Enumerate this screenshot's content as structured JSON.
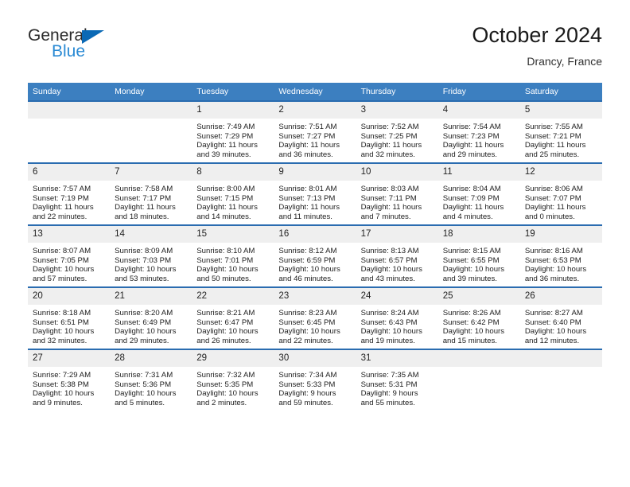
{
  "brand": {
    "name_top": "General",
    "name_bottom": "Blue",
    "triangle_color": "#0a69b5",
    "blue_text_color": "#2a8ad4"
  },
  "header": {
    "title": "October 2024",
    "subtitle": "Drancy, France"
  },
  "theme": {
    "header_row_bg": "#3c7fc0",
    "row_border": "#2a6cb0",
    "daynum_bg": "#efefef"
  },
  "weekday_headers": [
    "Sunday",
    "Monday",
    "Tuesday",
    "Wednesday",
    "Thursday",
    "Friday",
    "Saturday"
  ],
  "weeks": [
    [
      {
        "day": "",
        "empty": true
      },
      {
        "day": "",
        "empty": true
      },
      {
        "day": "1",
        "sunrise": "Sunrise: 7:49 AM",
        "sunset": "Sunset: 7:29 PM",
        "daylight_1": "Daylight: 11 hours",
        "daylight_2": "and 39 minutes."
      },
      {
        "day": "2",
        "sunrise": "Sunrise: 7:51 AM",
        "sunset": "Sunset: 7:27 PM",
        "daylight_1": "Daylight: 11 hours",
        "daylight_2": "and 36 minutes."
      },
      {
        "day": "3",
        "sunrise": "Sunrise: 7:52 AM",
        "sunset": "Sunset: 7:25 PM",
        "daylight_1": "Daylight: 11 hours",
        "daylight_2": "and 32 minutes."
      },
      {
        "day": "4",
        "sunrise": "Sunrise: 7:54 AM",
        "sunset": "Sunset: 7:23 PM",
        "daylight_1": "Daylight: 11 hours",
        "daylight_2": "and 29 minutes."
      },
      {
        "day": "5",
        "sunrise": "Sunrise: 7:55 AM",
        "sunset": "Sunset: 7:21 PM",
        "daylight_1": "Daylight: 11 hours",
        "daylight_2": "and 25 minutes."
      }
    ],
    [
      {
        "day": "6",
        "sunrise": "Sunrise: 7:57 AM",
        "sunset": "Sunset: 7:19 PM",
        "daylight_1": "Daylight: 11 hours",
        "daylight_2": "and 22 minutes."
      },
      {
        "day": "7",
        "sunrise": "Sunrise: 7:58 AM",
        "sunset": "Sunset: 7:17 PM",
        "daylight_1": "Daylight: 11 hours",
        "daylight_2": "and 18 minutes."
      },
      {
        "day": "8",
        "sunrise": "Sunrise: 8:00 AM",
        "sunset": "Sunset: 7:15 PM",
        "daylight_1": "Daylight: 11 hours",
        "daylight_2": "and 14 minutes."
      },
      {
        "day": "9",
        "sunrise": "Sunrise: 8:01 AM",
        "sunset": "Sunset: 7:13 PM",
        "daylight_1": "Daylight: 11 hours",
        "daylight_2": "and 11 minutes."
      },
      {
        "day": "10",
        "sunrise": "Sunrise: 8:03 AM",
        "sunset": "Sunset: 7:11 PM",
        "daylight_1": "Daylight: 11 hours",
        "daylight_2": "and 7 minutes."
      },
      {
        "day": "11",
        "sunrise": "Sunrise: 8:04 AM",
        "sunset": "Sunset: 7:09 PM",
        "daylight_1": "Daylight: 11 hours",
        "daylight_2": "and 4 minutes."
      },
      {
        "day": "12",
        "sunrise": "Sunrise: 8:06 AM",
        "sunset": "Sunset: 7:07 PM",
        "daylight_1": "Daylight: 11 hours",
        "daylight_2": "and 0 minutes."
      }
    ],
    [
      {
        "day": "13",
        "sunrise": "Sunrise: 8:07 AM",
        "sunset": "Sunset: 7:05 PM",
        "daylight_1": "Daylight: 10 hours",
        "daylight_2": "and 57 minutes."
      },
      {
        "day": "14",
        "sunrise": "Sunrise: 8:09 AM",
        "sunset": "Sunset: 7:03 PM",
        "daylight_1": "Daylight: 10 hours",
        "daylight_2": "and 53 minutes."
      },
      {
        "day": "15",
        "sunrise": "Sunrise: 8:10 AM",
        "sunset": "Sunset: 7:01 PM",
        "daylight_1": "Daylight: 10 hours",
        "daylight_2": "and 50 minutes."
      },
      {
        "day": "16",
        "sunrise": "Sunrise: 8:12 AM",
        "sunset": "Sunset: 6:59 PM",
        "daylight_1": "Daylight: 10 hours",
        "daylight_2": "and 46 minutes."
      },
      {
        "day": "17",
        "sunrise": "Sunrise: 8:13 AM",
        "sunset": "Sunset: 6:57 PM",
        "daylight_1": "Daylight: 10 hours",
        "daylight_2": "and 43 minutes."
      },
      {
        "day": "18",
        "sunrise": "Sunrise: 8:15 AM",
        "sunset": "Sunset: 6:55 PM",
        "daylight_1": "Daylight: 10 hours",
        "daylight_2": "and 39 minutes."
      },
      {
        "day": "19",
        "sunrise": "Sunrise: 8:16 AM",
        "sunset": "Sunset: 6:53 PM",
        "daylight_1": "Daylight: 10 hours",
        "daylight_2": "and 36 minutes."
      }
    ],
    [
      {
        "day": "20",
        "sunrise": "Sunrise: 8:18 AM",
        "sunset": "Sunset: 6:51 PM",
        "daylight_1": "Daylight: 10 hours",
        "daylight_2": "and 32 minutes."
      },
      {
        "day": "21",
        "sunrise": "Sunrise: 8:20 AM",
        "sunset": "Sunset: 6:49 PM",
        "daylight_1": "Daylight: 10 hours",
        "daylight_2": "and 29 minutes."
      },
      {
        "day": "22",
        "sunrise": "Sunrise: 8:21 AM",
        "sunset": "Sunset: 6:47 PM",
        "daylight_1": "Daylight: 10 hours",
        "daylight_2": "and 26 minutes."
      },
      {
        "day": "23",
        "sunrise": "Sunrise: 8:23 AM",
        "sunset": "Sunset: 6:45 PM",
        "daylight_1": "Daylight: 10 hours",
        "daylight_2": "and 22 minutes."
      },
      {
        "day": "24",
        "sunrise": "Sunrise: 8:24 AM",
        "sunset": "Sunset: 6:43 PM",
        "daylight_1": "Daylight: 10 hours",
        "daylight_2": "and 19 minutes."
      },
      {
        "day": "25",
        "sunrise": "Sunrise: 8:26 AM",
        "sunset": "Sunset: 6:42 PM",
        "daylight_1": "Daylight: 10 hours",
        "daylight_2": "and 15 minutes."
      },
      {
        "day": "26",
        "sunrise": "Sunrise: 8:27 AM",
        "sunset": "Sunset: 6:40 PM",
        "daylight_1": "Daylight: 10 hours",
        "daylight_2": "and 12 minutes."
      }
    ],
    [
      {
        "day": "27",
        "sunrise": "Sunrise: 7:29 AM",
        "sunset": "Sunset: 5:38 PM",
        "daylight_1": "Daylight: 10 hours",
        "daylight_2": "and 9 minutes."
      },
      {
        "day": "28",
        "sunrise": "Sunrise: 7:31 AM",
        "sunset": "Sunset: 5:36 PM",
        "daylight_1": "Daylight: 10 hours",
        "daylight_2": "and 5 minutes."
      },
      {
        "day": "29",
        "sunrise": "Sunrise: 7:32 AM",
        "sunset": "Sunset: 5:35 PM",
        "daylight_1": "Daylight: 10 hours",
        "daylight_2": "and 2 minutes."
      },
      {
        "day": "30",
        "sunrise": "Sunrise: 7:34 AM",
        "sunset": "Sunset: 5:33 PM",
        "daylight_1": "Daylight: 9 hours",
        "daylight_2": "and 59 minutes."
      },
      {
        "day": "31",
        "sunrise": "Sunrise: 7:35 AM",
        "sunset": "Sunset: 5:31 PM",
        "daylight_1": "Daylight: 9 hours",
        "daylight_2": "and 55 minutes."
      },
      {
        "day": "",
        "empty": true
      },
      {
        "day": "",
        "empty": true
      }
    ]
  ]
}
